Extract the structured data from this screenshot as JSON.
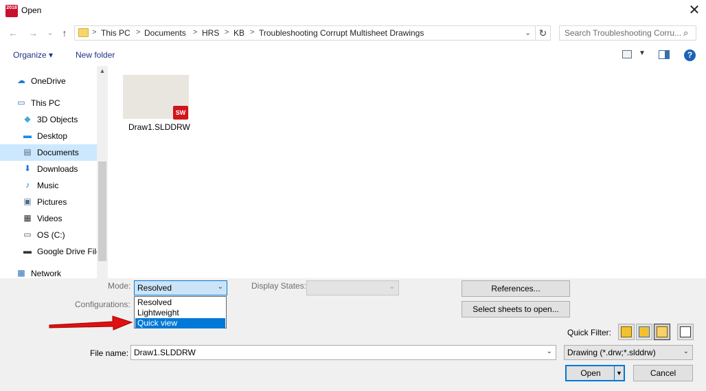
{
  "window": {
    "title": "Open",
    "app_icon_text": "2018",
    "close_glyph": "✕"
  },
  "nav_buttons": {
    "back": "←",
    "forward": "→",
    "recent": "⌄",
    "up": "↑"
  },
  "address": {
    "crumbs": [
      "This PC",
      "Documents",
      "HRS",
      "KB",
      "Troubleshooting Corrupt Multisheet Drawings"
    ],
    "separator": ">",
    "refresh_glyph": "↻"
  },
  "search": {
    "placeholder": "Search Troubleshooting Corru..."
  },
  "toolbar": {
    "organize_label": "Organize ▾",
    "newfolder_label": "New folder",
    "help_glyph": "?"
  },
  "sidebar": {
    "items": [
      {
        "label": "OneDrive",
        "icon": "cloud-icon",
        "glyph": "☁",
        "color": "#1e78d7"
      },
      {
        "label": "This PC",
        "icon": "computer-icon",
        "glyph": "▭",
        "color": "#2d6db5"
      },
      {
        "label": "3D Objects",
        "icon": "cube-icon",
        "glyph": "◆",
        "color": "#47a6d8"
      },
      {
        "label": "Desktop",
        "icon": "desktop-icon",
        "glyph": "▬",
        "color": "#1e88e5"
      },
      {
        "label": "Documents",
        "icon": "document-icon",
        "glyph": "▤",
        "color": "#5a6b7b"
      },
      {
        "label": "Downloads",
        "icon": "download-icon",
        "glyph": "⬇",
        "color": "#1e78d7"
      },
      {
        "label": "Music",
        "icon": "music-icon",
        "glyph": "♪",
        "color": "#1e78d7"
      },
      {
        "label": "Pictures",
        "icon": "pictures-icon",
        "glyph": "▣",
        "color": "#4a6d8c"
      },
      {
        "label": "Videos",
        "icon": "video-icon",
        "glyph": "▦",
        "color": "#333"
      },
      {
        "label": "OS (C:)",
        "icon": "drive-icon",
        "glyph": "▭",
        "color": "#555"
      },
      {
        "label": "Google Drive File",
        "icon": "drive-icon",
        "glyph": "▬",
        "color": "#333"
      },
      {
        "label": "Network",
        "icon": "network-icon",
        "glyph": "▩",
        "color": "#2d6db5"
      }
    ]
  },
  "content": {
    "files": [
      {
        "name": "Draw1.SLDDRW",
        "badge": "SW"
      }
    ]
  },
  "options": {
    "mode_label": "Mode:",
    "mode_value": "Resolved",
    "mode_options": [
      "Resolved",
      "Lightweight",
      "Quick view"
    ],
    "display_states_label": "Display States:",
    "configurations_label": "Configurations:",
    "references_label": "References...",
    "select_sheets_label": "Select sheets to open...",
    "quick_filter_label": "Quick Filter:"
  },
  "file_name": {
    "label": "File name:",
    "value": "Draw1.SLDDRW"
  },
  "file_type": {
    "value": "Drawing (*.drw;*.slddrw)"
  },
  "actions": {
    "open_label": "Open",
    "cancel_label": "Cancel"
  },
  "colors": {
    "accent": "#0078d7",
    "selection": "#cce8ff",
    "annotation_arrow": "#e01010"
  }
}
